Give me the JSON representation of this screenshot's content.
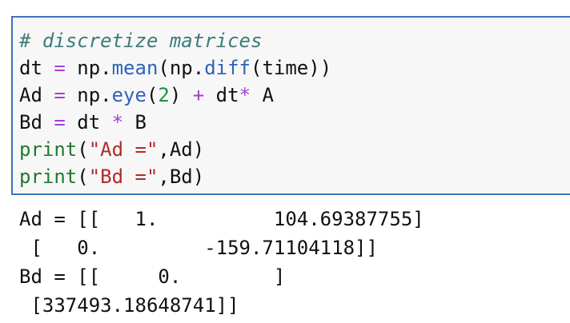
{
  "code": {
    "lines": [
      [
        {
          "text": "# discretize matrices",
          "type": "comment"
        }
      ],
      [
        {
          "text": "dt",
          "type": "default"
        },
        {
          "text": " ",
          "type": "default"
        },
        {
          "text": "=",
          "type": "op"
        },
        {
          "text": " np.",
          "type": "default"
        },
        {
          "text": "mean",
          "type": "fn"
        },
        {
          "text": "(np.",
          "type": "default"
        },
        {
          "text": "diff",
          "type": "fn"
        },
        {
          "text": "(time))",
          "type": "default"
        }
      ],
      [
        {
          "text": "Ad",
          "type": "default"
        },
        {
          "text": " ",
          "type": "default"
        },
        {
          "text": "=",
          "type": "op"
        },
        {
          "text": " np.",
          "type": "default"
        },
        {
          "text": "eye",
          "type": "fn"
        },
        {
          "text": "(",
          "type": "default"
        },
        {
          "text": "2",
          "type": "num"
        },
        {
          "text": ") ",
          "type": "default"
        },
        {
          "text": "+",
          "type": "op"
        },
        {
          "text": " dt",
          "type": "default"
        },
        {
          "text": "*",
          "type": "op"
        },
        {
          "text": " A",
          "type": "default"
        }
      ],
      [
        {
          "text": "Bd",
          "type": "default"
        },
        {
          "text": " ",
          "type": "default"
        },
        {
          "text": "=",
          "type": "op"
        },
        {
          "text": " dt ",
          "type": "default"
        },
        {
          "text": "*",
          "type": "op"
        },
        {
          "text": " B",
          "type": "default"
        }
      ],
      [
        {
          "text": "print",
          "type": "builtin"
        },
        {
          "text": "(",
          "type": "default"
        },
        {
          "text": "\"Ad =\"",
          "type": "str"
        },
        {
          "text": ",Ad)",
          "type": "default"
        }
      ],
      [
        {
          "text": "print",
          "type": "builtin"
        },
        {
          "text": "(",
          "type": "default"
        },
        {
          "text": "\"Bd =\"",
          "type": "str"
        },
        {
          "text": ",Bd)",
          "type": "default"
        }
      ]
    ]
  },
  "output": {
    "lines": [
      "Ad = [[   1.          104.69387755]",
      " [   0.         -159.71104118]]",
      "Bd = [[     0.        ]",
      " [337493.18648741]]"
    ]
  }
}
